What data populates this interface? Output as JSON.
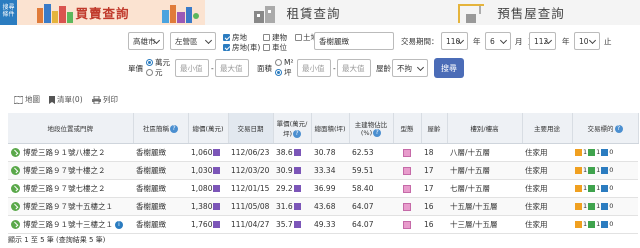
{
  "side_tab": "搜尋條件",
  "tabs": [
    {
      "label": "買賣查詢",
      "active": true
    },
    {
      "label": "租賃查詢",
      "active": false
    },
    {
      "label": "預售屋查詢",
      "active": false
    }
  ],
  "search": {
    "city": "高雄市",
    "district": "左營區",
    "checks": [
      {
        "label": "房地",
        "checked": true
      },
      {
        "label": "建物",
        "checked": false
      },
      {
        "label": "土地",
        "checked": false
      },
      {
        "label": "房地(車)",
        "checked": true
      },
      {
        "label": "車位",
        "checked": false
      }
    ],
    "community": "香榭麗緻",
    "period_label": "交易期間：",
    "from_year": "110",
    "year_unit": "年",
    "from_month": "6",
    "month_unit": "月",
    "to_label": "至",
    "to_year": "112",
    "to_month": "10",
    "stop_label": "止",
    "price_label": "單價",
    "unit_options": [
      "萬元",
      "元"
    ],
    "min_placeholder": "最小值",
    "max_placeholder": "最大值",
    "area_label": "面積",
    "area_options": [
      "M²",
      "坪"
    ],
    "age_label": "屋齡",
    "age_value": "不拘",
    "submit_label": "搜尋"
  },
  "toolbar": {
    "map_label": "地圖",
    "list_label": "清單(0)",
    "print_label": "列印"
  },
  "table": {
    "headers": [
      "地段位置或門牌",
      "社區簡稱",
      "總價(萬元)",
      "交易日期",
      "單價(萬元/坪)",
      "總面積(坪)",
      "主建物佔比(%)",
      "型態",
      "屋齡",
      "樓別/樓高",
      "主要用途",
      "交易標的"
    ],
    "rows": [
      {
        "address": "博愛三路９１號八樓之２",
        "community": "香榭麗緻",
        "total": "1,060",
        "date": "112/06/23",
        "unit": "38.6",
        "area": "30.78",
        "ratio": "62.53",
        "age": "18",
        "floor": "八層/十五層",
        "use": "住家用",
        "info": false
      },
      {
        "address": "博愛三路９７號十樓之２",
        "community": "香榭麗緻",
        "total": "1,030",
        "date": "112/03/20",
        "unit": "30.9",
        "area": "33.34",
        "ratio": "59.51",
        "age": "17",
        "floor": "十層/十五層",
        "use": "住家用",
        "info": false
      },
      {
        "address": "博愛三路９７號七樓之２",
        "community": "香榭麗緻",
        "total": "1,080",
        "date": "112/01/15",
        "unit": "29.2",
        "area": "36.99",
        "ratio": "58.40",
        "age": "17",
        "floor": "七層/十五層",
        "use": "住家用",
        "info": false
      },
      {
        "address": "博愛三路９７號十五樓之１",
        "community": "香榭麗緻",
        "total": "1,380",
        "date": "111/05/08",
        "unit": "31.6",
        "area": "43.68",
        "ratio": "64.07",
        "age": "16",
        "floor": "十五層/十五層",
        "use": "住家用",
        "info": false
      },
      {
        "address": "博愛三路９１號十三樓之１",
        "community": "香榭麗緻",
        "total": "1,760",
        "date": "111/04/27",
        "unit": "35.7",
        "area": "49.33",
        "ratio": "64.07",
        "age": "16",
        "floor": "十三層/十五層",
        "use": "住家用",
        "info": true
      }
    ],
    "trans_values": [
      "1",
      "1",
      "0"
    ]
  },
  "footer": "顯示 1 至 5 筆 (查詢結果 5 筆)"
}
